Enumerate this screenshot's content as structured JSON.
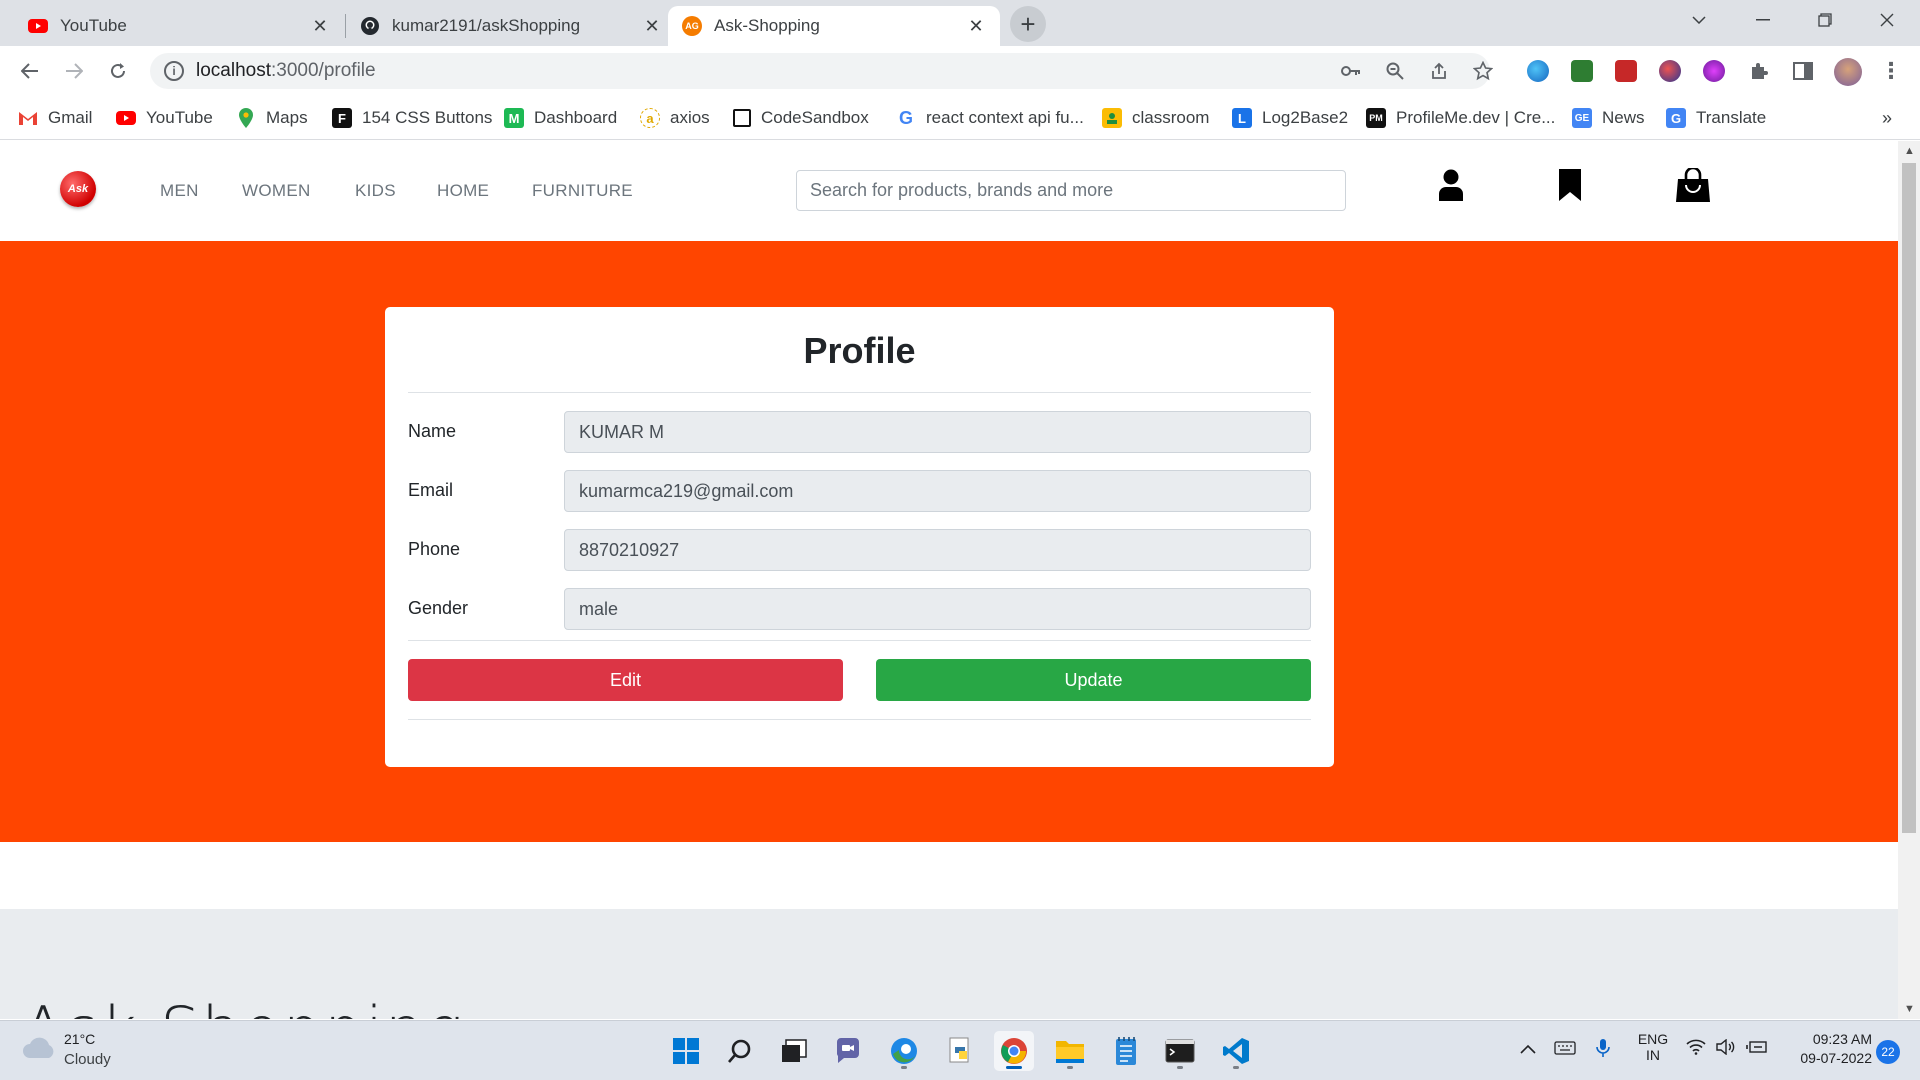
{
  "tabs": [
    {
      "title": "YouTube",
      "icon": "youtube-icon",
      "active": false
    },
    {
      "title": "kumar2191/askShopping",
      "icon": "github-icon",
      "active": false
    },
    {
      "title": "Ask-Shopping",
      "icon": "ag-icon",
      "active": true
    }
  ],
  "tab_ag_icon_text": "AG",
  "address": {
    "host": "localhost",
    "path": ":3000/profile"
  },
  "bookmarks": [
    {
      "label": "Gmail"
    },
    {
      "label": "YouTube"
    },
    {
      "label": "Maps"
    },
    {
      "label": "154 CSS Buttons"
    },
    {
      "label": "Dashboard"
    },
    {
      "label": "axios"
    },
    {
      "label": "CodeSandbox"
    },
    {
      "label": "react context api fu..."
    },
    {
      "label": "classroom"
    },
    {
      "label": "Log2Base2"
    },
    {
      "label": "ProfileMe.dev | Cre..."
    },
    {
      "label": "News"
    },
    {
      "label": "Translate"
    }
  ],
  "bookmarks_overflow": "»",
  "site": {
    "logo_text": "Ask",
    "menu": [
      "MEN",
      "WOMEN",
      "KIDS",
      "HOME",
      "FURNITURE"
    ],
    "search_placeholder": "Search for products, brands and more"
  },
  "profile": {
    "title": "Profile",
    "fields": [
      {
        "label": "Name",
        "value": "KUMAR M"
      },
      {
        "label": "Email",
        "value": "kumarmca219@gmail.com"
      },
      {
        "label": "Phone",
        "value": "8870210927"
      },
      {
        "label": "Gender",
        "value": "male"
      }
    ],
    "edit_label": "Edit",
    "update_label": "Update"
  },
  "footer": {
    "brand": "Ask Shopping"
  },
  "colors": {
    "hero_bg": "#ff4500",
    "edit_btn": "#dc3545",
    "update_btn": "#28a745"
  },
  "taskbar": {
    "weather_temp": "21°C",
    "weather_desc": "Cloudy",
    "lang": "ENG",
    "region": "IN",
    "time": "09:23 AM",
    "date": "09-07-2022",
    "notifications": "22"
  }
}
